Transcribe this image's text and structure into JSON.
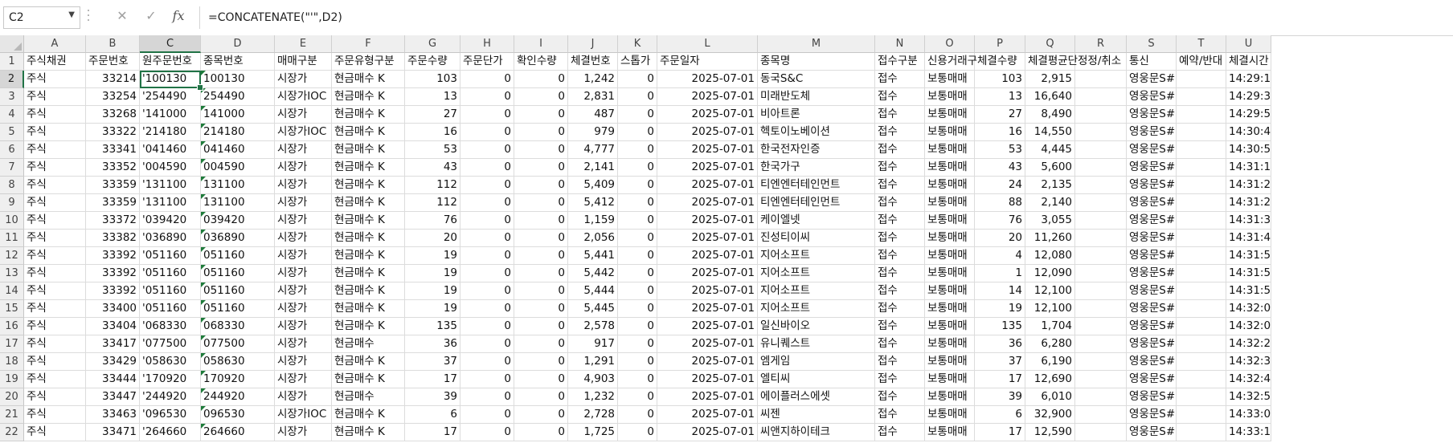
{
  "formula_bar": {
    "name_box": "C2",
    "formula": "=CONCATENATE(\"'\",D2)",
    "cancel_symbol": "✕",
    "enter_symbol": "✓",
    "fx_symbol": "fx"
  },
  "columns": [
    "A",
    "B",
    "C",
    "D",
    "E",
    "F",
    "G",
    "H",
    "I",
    "J",
    "K",
    "L",
    "M",
    "N",
    "O",
    "P",
    "Q",
    "R",
    "S",
    "T",
    "U"
  ],
  "selected_column": "C",
  "selected_row": 2,
  "header_row": [
    "주식채권",
    "주문번호",
    "원주문번호",
    "종목번호",
    "매매구분",
    "주문유형구분",
    "주문수량",
    "주문단가",
    "확인수량",
    "체결번호",
    "스톱가",
    "주문일자",
    "종목명",
    "접수구분",
    "신용거래구",
    "체결수량",
    "체결평균단",
    "정정/취소",
    "통신",
    "예약/반대",
    "체결시간"
  ],
  "rows": [
    [
      "주식",
      "33214",
      "'100130",
      "100130",
      "시장가",
      "현금매수 K",
      "103",
      "0",
      "0",
      "1,242",
      "0",
      "2025-07-01",
      "동국S&C",
      "접수",
      "보통매매",
      "103",
      "2,915",
      "",
      "영웅문S#",
      "",
      "14:29:1"
    ],
    [
      "주식",
      "33254",
      "'254490",
      "254490",
      "시장가IOC",
      "현금매수 K",
      "13",
      "0",
      "0",
      "2,831",
      "0",
      "2025-07-01",
      "미래반도체",
      "접수",
      "보통매매",
      "13",
      "16,640",
      "",
      "영웅문S#",
      "",
      "14:29:3"
    ],
    [
      "주식",
      "33268",
      "'141000",
      "141000",
      "시장가",
      "현금매수 K",
      "27",
      "0",
      "0",
      "487",
      "0",
      "2025-07-01",
      "비아트론",
      "접수",
      "보통매매",
      "27",
      "8,490",
      "",
      "영웅문S#",
      "",
      "14:29:5"
    ],
    [
      "주식",
      "33322",
      "'214180",
      "214180",
      "시장가IOC",
      "현금매수 K",
      "16",
      "0",
      "0",
      "979",
      "0",
      "2025-07-01",
      "헥토이노베이션",
      "접수",
      "보통매매",
      "16",
      "14,550",
      "",
      "영웅문S#",
      "",
      "14:30:4"
    ],
    [
      "주식",
      "33341",
      "'041460",
      "041460",
      "시장가",
      "현금매수 K",
      "53",
      "0",
      "0",
      "4,777",
      "0",
      "2025-07-01",
      "한국전자인증",
      "접수",
      "보통매매",
      "53",
      "4,445",
      "",
      "영웅문S#",
      "",
      "14:30:5"
    ],
    [
      "주식",
      "33352",
      "'004590",
      "004590",
      "시장가",
      "현금매수 K",
      "43",
      "0",
      "0",
      "2,141",
      "0",
      "2025-07-01",
      "한국가구",
      "접수",
      "보통매매",
      "43",
      "5,600",
      "",
      "영웅문S#",
      "",
      "14:31:1"
    ],
    [
      "주식",
      "33359",
      "'131100",
      "131100",
      "시장가",
      "현금매수 K",
      "112",
      "0",
      "0",
      "5,409",
      "0",
      "2025-07-01",
      "티엔엔터테인먼트",
      "접수",
      "보통매매",
      "24",
      "2,135",
      "",
      "영웅문S#",
      "",
      "14:31:2"
    ],
    [
      "주식",
      "33359",
      "'131100",
      "131100",
      "시장가",
      "현금매수 K",
      "112",
      "0",
      "0",
      "5,412",
      "0",
      "2025-07-01",
      "티엔엔터테인먼트",
      "접수",
      "보통매매",
      "88",
      "2,140",
      "",
      "영웅문S#",
      "",
      "14:31:2"
    ],
    [
      "주식",
      "33372",
      "'039420",
      "039420",
      "시장가",
      "현금매수 K",
      "76",
      "0",
      "0",
      "1,159",
      "0",
      "2025-07-01",
      "케이엘넷",
      "접수",
      "보통매매",
      "76",
      "3,055",
      "",
      "영웅문S#",
      "",
      "14:31:3"
    ],
    [
      "주식",
      "33382",
      "'036890",
      "036890",
      "시장가",
      "현금매수 K",
      "20",
      "0",
      "0",
      "2,056",
      "0",
      "2025-07-01",
      "진성티이씨",
      "접수",
      "보통매매",
      "20",
      "11,260",
      "",
      "영웅문S#",
      "",
      "14:31:4"
    ],
    [
      "주식",
      "33392",
      "'051160",
      "051160",
      "시장가",
      "현금매수 K",
      "19",
      "0",
      "0",
      "5,441",
      "0",
      "2025-07-01",
      "지어소프트",
      "접수",
      "보통매매",
      "4",
      "12,080",
      "",
      "영웅문S#",
      "",
      "14:31:5"
    ],
    [
      "주식",
      "33392",
      "'051160",
      "051160",
      "시장가",
      "현금매수 K",
      "19",
      "0",
      "0",
      "5,442",
      "0",
      "2025-07-01",
      "지어소프트",
      "접수",
      "보통매매",
      "1",
      "12,090",
      "",
      "영웅문S#",
      "",
      "14:31:5"
    ],
    [
      "주식",
      "33392",
      "'051160",
      "051160",
      "시장가",
      "현금매수 K",
      "19",
      "0",
      "0",
      "5,444",
      "0",
      "2025-07-01",
      "지어소프트",
      "접수",
      "보통매매",
      "14",
      "12,100",
      "",
      "영웅문S#",
      "",
      "14:31:5"
    ],
    [
      "주식",
      "33400",
      "'051160",
      "051160",
      "시장가",
      "현금매수 K",
      "19",
      "0",
      "0",
      "5,445",
      "0",
      "2025-07-01",
      "지어소프트",
      "접수",
      "보통매매",
      "19",
      "12,100",
      "",
      "영웅문S#",
      "",
      "14:32:0"
    ],
    [
      "주식",
      "33404",
      "'068330",
      "068330",
      "시장가",
      "현금매수 K",
      "135",
      "0",
      "0",
      "2,578",
      "0",
      "2025-07-01",
      "일신바이오",
      "접수",
      "보통매매",
      "135",
      "1,704",
      "",
      "영웅문S#",
      "",
      "14:32:0"
    ],
    [
      "주식",
      "33417",
      "'077500",
      "077500",
      "시장가",
      "현금매수",
      "36",
      "0",
      "0",
      "917",
      "0",
      "2025-07-01",
      "유니퀘스트",
      "접수",
      "보통매매",
      "36",
      "6,280",
      "",
      "영웅문S#",
      "",
      "14:32:2"
    ],
    [
      "주식",
      "33429",
      "'058630",
      "058630",
      "시장가",
      "현금매수 K",
      "37",
      "0",
      "0",
      "1,291",
      "0",
      "2025-07-01",
      "엠게임",
      "접수",
      "보통매매",
      "37",
      "6,190",
      "",
      "영웅문S#",
      "",
      "14:32:3"
    ],
    [
      "주식",
      "33444",
      "'170920",
      "170920",
      "시장가",
      "현금매수 K",
      "17",
      "0",
      "0",
      "4,903",
      "0",
      "2025-07-01",
      "엘티씨",
      "접수",
      "보통매매",
      "17",
      "12,690",
      "",
      "영웅문S#",
      "",
      "14:32:4"
    ],
    [
      "주식",
      "33447",
      "'244920",
      "244920",
      "시장가",
      "현금매수",
      "39",
      "0",
      "0",
      "1,232",
      "0",
      "2025-07-01",
      "에이플러스에셋",
      "접수",
      "보통매매",
      "39",
      "6,010",
      "",
      "영웅문S#",
      "",
      "14:32:5"
    ],
    [
      "주식",
      "33463",
      "'096530",
      "096530",
      "시장가IOC",
      "현금매수 K",
      "6",
      "0",
      "0",
      "2,728",
      "0",
      "2025-07-01",
      "씨젠",
      "접수",
      "보통매매",
      "6",
      "32,900",
      "",
      "영웅문S#",
      "",
      "14:33:0"
    ],
    [
      "주식",
      "33471",
      "'264660",
      "264660",
      "시장가",
      "현금매수 K",
      "17",
      "0",
      "0",
      "1,725",
      "0",
      "2025-07-01",
      "씨앤지하이테크",
      "접수",
      "보통매매",
      "17",
      "12,590",
      "",
      "영웅문S#",
      "",
      "14:33:1"
    ]
  ],
  "colors": {
    "accent": "#217346",
    "header_bg": "#efefef",
    "selected_header_bg": "#d6d6d6",
    "grid_line": "#dcdcdc"
  }
}
